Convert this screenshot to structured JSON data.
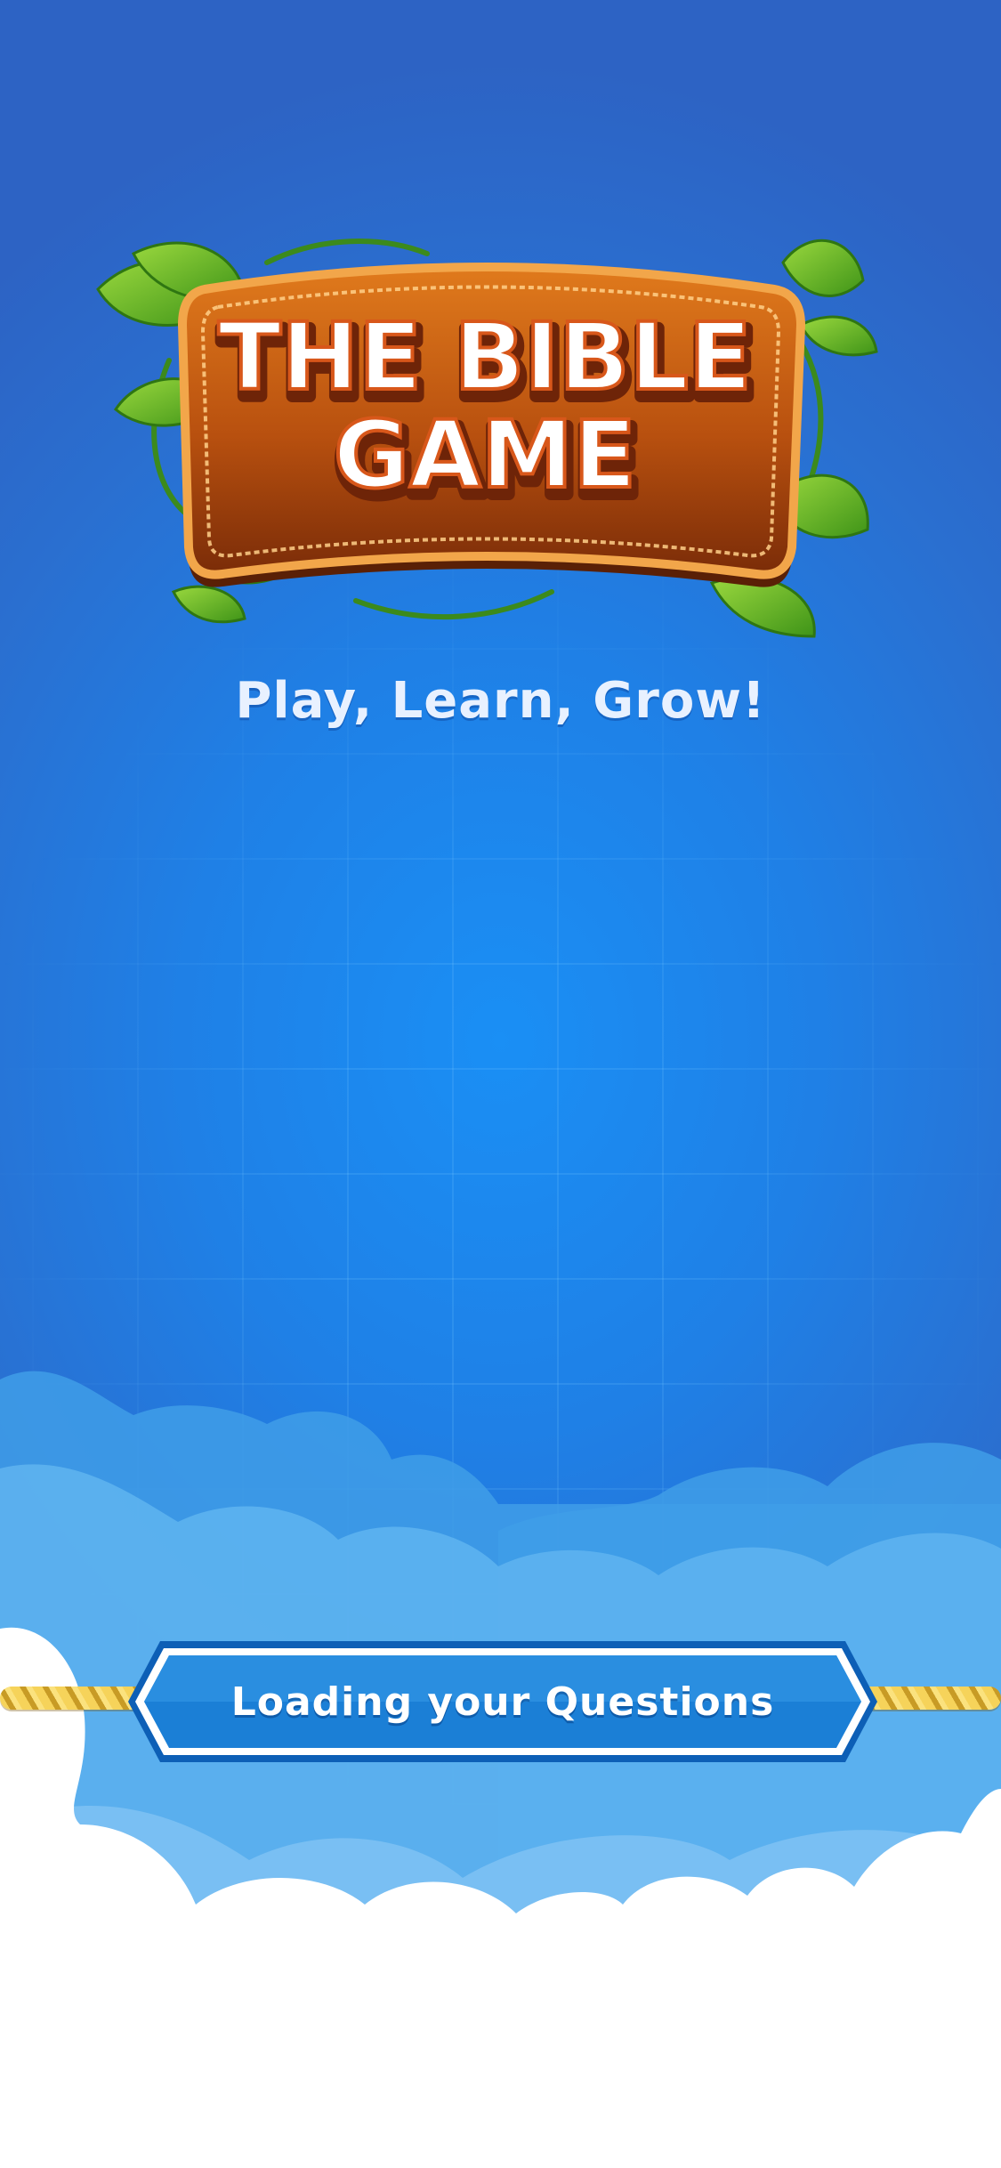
{
  "logo": {
    "line1": "THE BIBLE",
    "line2": "GAME"
  },
  "tagline": "Play, Learn, Grow!",
  "loading": {
    "label": "Loading your Questions"
  },
  "colors": {
    "background": "#1f80e6",
    "sign_wood": "#b8500f",
    "sign_border": "#f2a64a",
    "leaf": "#6dbb2a",
    "button": "#1b7fd6",
    "button_border": "#ffffff",
    "rope": "#f6d35a"
  },
  "icons": [
    "leaf-icon",
    "vine-icon",
    "cloud-icon",
    "rope-icon"
  ]
}
